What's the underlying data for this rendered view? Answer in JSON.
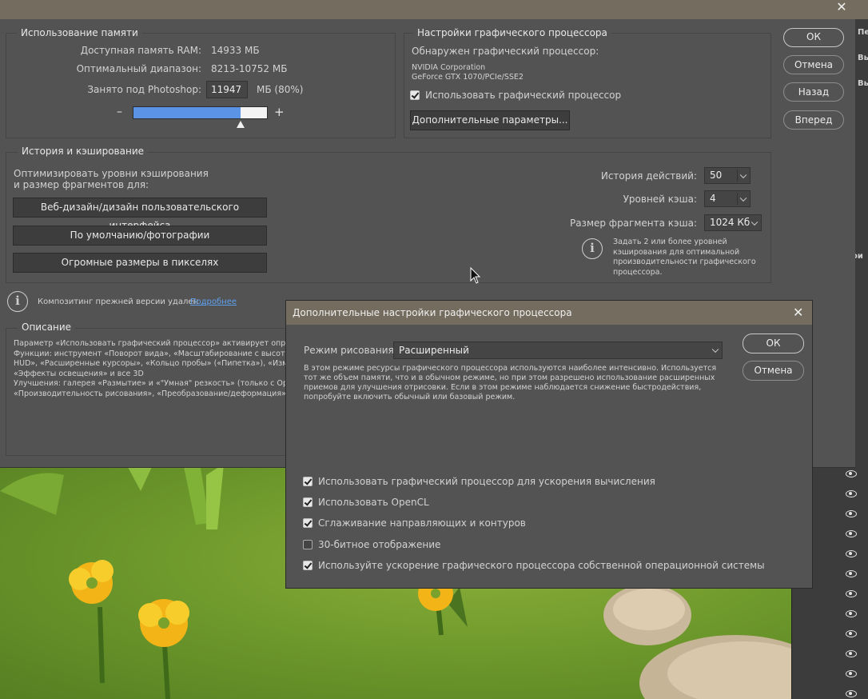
{
  "preferences": {
    "memory": {
      "title": "Использование памяти",
      "ram_label": "Доступная память RAM:",
      "ram_value": "14933 МБ",
      "range_label": "Оптимальный диапазон:",
      "range_value": "8213-10752 МБ",
      "usage_label": "Занято под Photoshop:",
      "usage_value": "11947",
      "usage_unit": "МБ (80%)",
      "usage_fraction": 0.8,
      "minus": "–",
      "plus": "+"
    },
    "gpu": {
      "title": "Настройки графического процессора",
      "detected_label": "Обнаружен графический процессор:",
      "vendor": "NVIDIA Corporation",
      "model": "GeForce GTX 1070/PCIe/SSE2",
      "use_gpu_label": "Использовать графический процессор",
      "use_gpu_checked": true,
      "advanced_button": "Дополнительные параметры..."
    },
    "buttons": {
      "ok": "ОК",
      "cancel": "Отмена",
      "back": "Назад",
      "forward": "Вперед"
    },
    "history": {
      "title": "История и кэширование",
      "optimize_line1": "Оптимизировать уровни кэширования",
      "optimize_line2": "и размер фрагментов для:",
      "preset_web": "Веб-дизайн/дизайн пользовательского интерфейса",
      "preset_default": "По умолчанию/фотографии",
      "preset_huge": "Огромные размеры в пикселях",
      "history_states_label": "История действий:",
      "history_states_value": "50",
      "cache_levels_label": "Уровней кэша:",
      "cache_levels_value": "4",
      "tile_size_label": "Размер фрагмента кэша:",
      "tile_size_value": "1024 Кб",
      "hint": "Задать 2 или более уровней кэширования для оптимальной производительности графического процессора."
    },
    "legacy": {
      "text": "Композитинг прежней версии удален",
      "link": "Подробнее"
    },
    "description": {
      "title": "Описание",
      "line1": "Параметр «Использовать графический процессор» активирует определ",
      "line2": "Функции: инструмент «Поворот вида», «Масштабирование с высоты пт",
      "line3": "HUD», «Расширенные курсоры», «Кольцо пробы» («Пипетка»), «Измен",
      "line4": "«Эффекты освещения» и все 3D",
      "line5": "Улучшения: галерея «Размытие» и «\"Умная\" резкость» (только с OpenC",
      "line6": "«Производительность рисования», «Преобразование/деформация»"
    }
  },
  "gpu_dialog": {
    "title": "Дополнительные настройки графического процессора",
    "close_icon": "close-icon",
    "mode_label": "Режим рисования:",
    "mode_value": "Расширенный",
    "mode_description": "В этом режиме ресурсы графического процессора используются наиболее интенсивно.  Используется тот же объем памяти, что и в обычном режиме, но при этом разрешено использование расширенных приемов для улучшения отрисовки.  Если в этом режиме наблюдается снижение быстродействия, попробуйте включить обычный или базовый режим.",
    "ok": "ОК",
    "cancel": "Отмена",
    "options": [
      {
        "label": "Использовать графический процессор для ускорения вычисления",
        "checked": true
      },
      {
        "label": "Использовать OpenCL",
        "checked": true
      },
      {
        "label": "Сглаживание направляющих и контуров",
        "checked": true
      },
      {
        "label": "30-битное отображение",
        "checked": false
      },
      {
        "label": "Используйте ускорение графического процессора собственной операционной системы",
        "checked": true
      }
    ]
  },
  "right_panel": {
    "items": [
      "Пе",
      "Вы",
      "Вы"
    ],
    "mid": "ои",
    "eye_rows": 12
  },
  "colors": {
    "dialog_bg": "#535353",
    "titlebar": "#746c5e",
    "slider_fill": "#5b93e6",
    "link": "#5ea0ef"
  }
}
